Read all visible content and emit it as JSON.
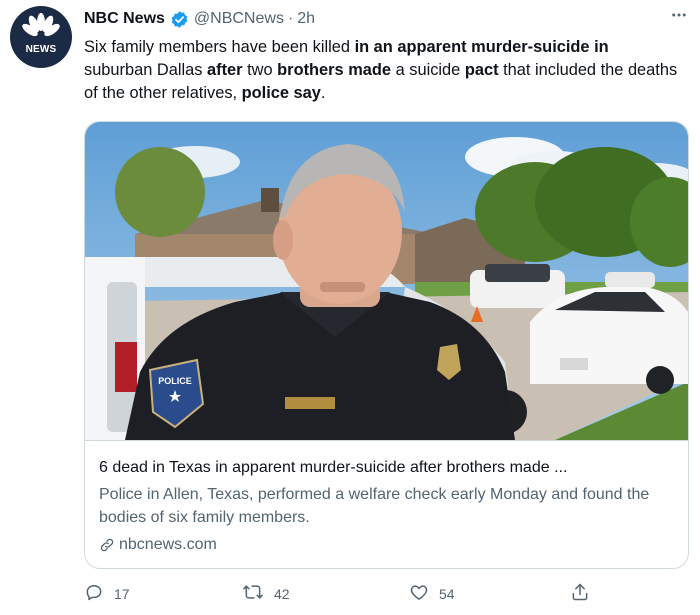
{
  "account": {
    "name": "NBC News",
    "handle": "@NBCNews",
    "separator": "·",
    "time": "2h",
    "avatar_label": "NEWS"
  },
  "tweet": {
    "segments": [
      {
        "text": "Six family members have been killed ",
        "bold": false
      },
      {
        "text": "in an apparent murder-suicide in",
        "bold": true
      },
      {
        "text": " suburban Dallas ",
        "bold": false
      },
      {
        "text": "after",
        "bold": true
      },
      {
        "text": " two ",
        "bold": false
      },
      {
        "text": "brothers made",
        "bold": true
      },
      {
        "text": " a suicide ",
        "bold": false
      },
      {
        "text": "pact",
        "bold": true
      },
      {
        "text": " that included the deaths of the other relatives, ",
        "bold": false
      },
      {
        "text": "police say",
        "bold": true
      },
      {
        "text": ".",
        "bold": false
      }
    ]
  },
  "card": {
    "image_alt": "Police officer speaking outside homes with parked cars",
    "patch_text": "POLICE",
    "title": "6 dead in Texas in apparent murder-suicide after brothers made ...",
    "description": "Police in Allen, Texas, performed a welfare check early Monday and found the bodies of six family members.",
    "domain": "nbcnews.com"
  },
  "actions": {
    "reply_count": "17",
    "retweet_count": "42",
    "like_count": "54"
  },
  "icons": {
    "verified": "verified-badge-icon",
    "more": "more-icon",
    "reply": "reply-icon",
    "retweet": "retweet-icon",
    "like": "like-icon",
    "share": "share-icon",
    "link": "link-icon"
  },
  "colors": {
    "verified": "#1d9bf0",
    "secondary_text": "#536471",
    "border": "#cfd9de"
  }
}
